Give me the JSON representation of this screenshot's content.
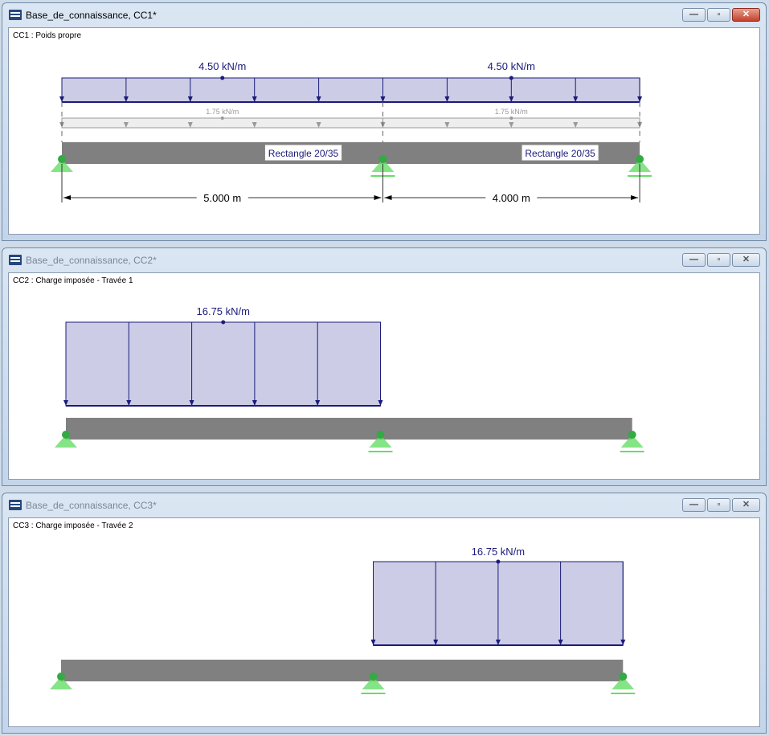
{
  "colors": {
    "load_fill": "#cccce6",
    "load_stroke": "#1b1b7a",
    "beam": "#808080",
    "support": "#66dd66",
    "self_weight": "#999999"
  },
  "windows": [
    {
      "title": "Base_de_connaissance, CC1*",
      "active": true,
      "caption": "CC1 : Poids propre",
      "spans_m": [
        5.0,
        4.0
      ],
      "loads": [
        {
          "label": "4.50 kN/m",
          "from": 0,
          "to": 5
        },
        {
          "label": "4.50 kN/m",
          "from": 5,
          "to": 9
        }
      ],
      "secondary_loads": [
        {
          "label": "1.75 kN/m",
          "from": 0,
          "to": 5
        },
        {
          "label": "1.75 kN/m",
          "from": 5,
          "to": 9
        }
      ],
      "section_labels": [
        "Rectangle 20/35",
        "Rectangle 20/35"
      ],
      "dimensions": [
        "5.000 m",
        "4.000 m"
      ]
    },
    {
      "title": "Base_de_connaissance, CC2*",
      "active": false,
      "caption": "CC2 : Charge imposée - Travée 1",
      "spans_m": [
        5.0,
        4.0
      ],
      "loads": [
        {
          "label": "16.75 kN/m",
          "from": 0,
          "to": 5
        }
      ]
    },
    {
      "title": "Base_de_connaissance, CC3*",
      "active": false,
      "caption": "CC3 : Charge imposée - Travée 2",
      "spans_m": [
        5.0,
        4.0
      ],
      "loads": [
        {
          "label": "16.75 kN/m",
          "from": 5,
          "to": 9
        }
      ]
    }
  ],
  "window_buttons": {
    "minimize": "—",
    "maximize": "▫",
    "close": "✕"
  }
}
